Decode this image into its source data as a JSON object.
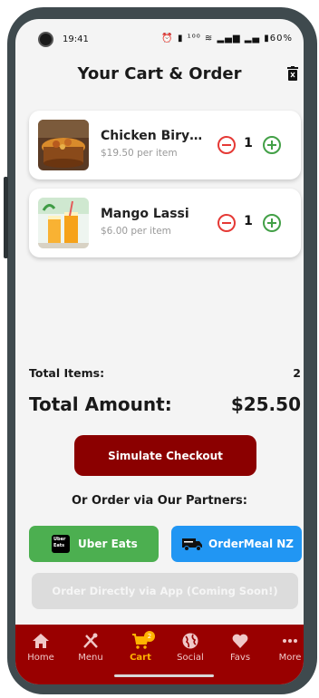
{
  "status_bar": {
    "time": "19:41",
    "indicators": "⏰ ▮ ¹⁰⁰ ≋ ▂▄▆ ▂▄ ▮60%"
  },
  "header": {
    "title": "Your Cart & Order",
    "clear_icon": "trash-icon"
  },
  "cart": {
    "items": [
      {
        "name": "Chicken Biryani",
        "price": "$19.50 per item",
        "quantity": "1",
        "image": "biryani-bowl"
      },
      {
        "name": "Mango Lassi",
        "price": "$6.00 per item",
        "quantity": "1",
        "image": "mango-lassi-glasses"
      }
    ]
  },
  "summary": {
    "total_items_label": "Total Items:",
    "total_items_value": "2",
    "total_amount_label": "Total Amount:",
    "total_amount_value": "$25.50"
  },
  "actions": {
    "checkout_label": "Simulate Checkout",
    "partners_heading": "Or Order via Our Partners:",
    "uber_label": "Uber Eats",
    "uber_logo_text": "Uber Eats",
    "ordermeal_label": "OrderMeal NZ",
    "direct_label": "Order Directly via App (Coming Soon!)"
  },
  "colors": {
    "brand_red": "#8b0000",
    "nav_red": "#990000",
    "uber_green": "#4caf50",
    "ordermeal_blue": "#2196f3",
    "active_nav": "#ffb300",
    "minus_red": "#e53935",
    "plus_green": "#43a047"
  },
  "nav": {
    "items": [
      {
        "label": "Home",
        "icon": "home-icon"
      },
      {
        "label": "Menu",
        "icon": "utensils-icon"
      },
      {
        "label": "Cart",
        "icon": "cart-icon",
        "badge": "2",
        "active": true
      },
      {
        "label": "Social",
        "icon": "globe-icon"
      },
      {
        "label": "Favs",
        "icon": "heart-icon"
      },
      {
        "label": "More",
        "icon": "more-icon"
      }
    ]
  }
}
